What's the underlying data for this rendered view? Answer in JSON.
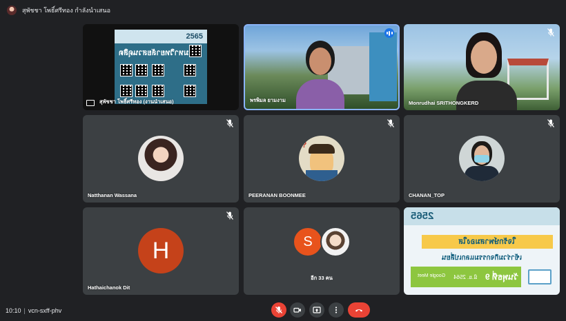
{
  "header": {
    "presenter_text": "สุพัชชา โพธิ์ศรีทอง กำลังนำเสนอ"
  },
  "tiles": {
    "presentation": {
      "name": "สุพัชชา โพธิ์ศรีทอง (งานนำเสนอ)",
      "slide_year": "2565",
      "slide_title": "มหาวิทยาลัยสวนดุสิต"
    },
    "cam1": {
      "name": "พรพิมล ยามงาม"
    },
    "cam2": {
      "name": "Monrudhai SRITHONGKERD"
    },
    "p1": {
      "name": "Natthanan Wassana"
    },
    "p2": {
      "name": "PEERANAN BOONMEE"
    },
    "p3": {
      "name": "CHANAN_TOP"
    },
    "p4": {
      "name": "Hathaichanok Dit",
      "initial": "H"
    },
    "others": {
      "label": "อีก 33 คน",
      "initial": "S"
    },
    "slide2": {
      "year": "2565",
      "line1": "ใจรักษ์พาสมองใส",
      "line2": "เข้าร่วมกิจกรรมแลกเปลี่ยน",
      "date_day": "วันพุธที่ 9",
      "date_rest": "มิ.ย. 2564",
      "platform": "Google Meet"
    }
  },
  "footer": {
    "time": "10:10",
    "separator": "|",
    "meeting_code": "vcn-sxff-phv"
  },
  "colors": {
    "background": "#202124",
    "tile": "#3c4043",
    "danger": "#ea4335",
    "speaking": "#1a73e8"
  }
}
